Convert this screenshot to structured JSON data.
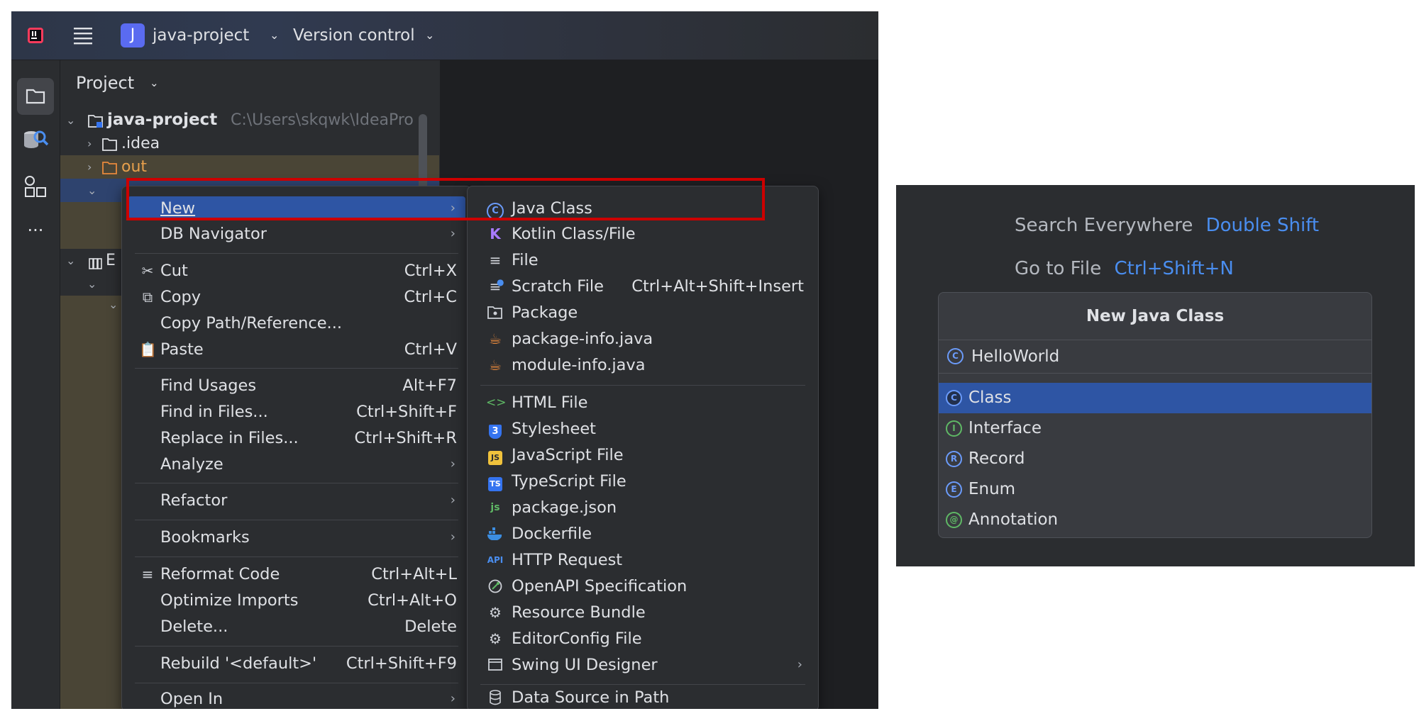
{
  "titlebar": {
    "project_badge": "J",
    "project_name": "java-project",
    "vcs_label": "Version control"
  },
  "sidebar": {
    "icons": [
      "folder-icon",
      "db-search-icon",
      "plugins-icon",
      "more-icon"
    ],
    "more_label": "···"
  },
  "project_panel": {
    "title": "Project",
    "rows": [
      {
        "name": "java-project",
        "path": "C:\\Users\\skqwk\\IdeaPro"
      },
      {
        "name": ".idea"
      },
      {
        "name": "out"
      }
    ],
    "partial_row_letter": "E"
  },
  "context_menu": {
    "items": [
      {
        "label": "New",
        "shortcut": "",
        "submenu": true
      },
      {
        "label": "DB Navigator",
        "shortcut": "",
        "submenu": true
      },
      {
        "label": "Cut",
        "shortcut": "Ctrl+X",
        "icon": "scissors-icon"
      },
      {
        "label": "Copy",
        "shortcut": "Ctrl+C",
        "icon": "copy-icon"
      },
      {
        "label": "Copy Path/Reference...",
        "shortcut": ""
      },
      {
        "label": "Paste",
        "shortcut": "Ctrl+V",
        "icon": "paste-icon"
      },
      {
        "label": "Find Usages",
        "shortcut": "Alt+F7"
      },
      {
        "label": "Find in Files...",
        "shortcut": "Ctrl+Shift+F"
      },
      {
        "label": "Replace in Files...",
        "shortcut": "Ctrl+Shift+R"
      },
      {
        "label": "Analyze",
        "shortcut": "",
        "submenu": true
      },
      {
        "label": "Refactor",
        "shortcut": "",
        "submenu": true
      },
      {
        "label": "Bookmarks",
        "shortcut": "",
        "submenu": true
      },
      {
        "label": "Reformat Code",
        "shortcut": "Ctrl+Alt+L",
        "icon": "reformat-icon"
      },
      {
        "label": "Optimize Imports",
        "shortcut": "Ctrl+Alt+O"
      },
      {
        "label": "Delete...",
        "shortcut": "Delete"
      },
      {
        "label": "Rebuild '<default>'",
        "shortcut": "Ctrl+Shift+F9"
      },
      {
        "label": "Open In",
        "shortcut": "",
        "submenu": true
      }
    ]
  },
  "new_submenu": {
    "items": [
      {
        "label": "Java Class",
        "icon": "java-class-icon"
      },
      {
        "label": "Kotlin Class/File",
        "icon": "kotlin-icon"
      },
      {
        "label": "File",
        "icon": "file-icon"
      },
      {
        "label": "Scratch File",
        "shortcut": "Ctrl+Alt+Shift+Insert",
        "icon": "scratch-file-icon"
      },
      {
        "label": "Package",
        "icon": "package-icon"
      },
      {
        "label": "package-info.java",
        "icon": "java-cup-icon"
      },
      {
        "label": "module-info.java",
        "icon": "java-cup-icon"
      },
      {
        "label": "HTML File",
        "icon": "html-icon"
      },
      {
        "label": "Stylesheet",
        "icon": "css-icon"
      },
      {
        "label": "JavaScript File",
        "icon": "javascript-icon"
      },
      {
        "label": "TypeScript File",
        "icon": "typescript-icon"
      },
      {
        "label": "package.json",
        "icon": "nodejs-icon"
      },
      {
        "label": "Dockerfile",
        "icon": "docker-icon"
      },
      {
        "label": "HTTP Request",
        "icon": "api-icon"
      },
      {
        "label": "OpenAPI Specification",
        "icon": "openapi-icon"
      },
      {
        "label": "Resource Bundle",
        "icon": "gear-icon"
      },
      {
        "label": "EditorConfig File",
        "icon": "gear-icon"
      },
      {
        "label": "Swing UI Designer",
        "icon": "window-icon",
        "submenu": true
      },
      {
        "label": "Data Source in Path",
        "icon": "database-icon"
      }
    ],
    "glyphs": {
      "java_class": "C",
      "kotlin": "K",
      "html": "<>",
      "css": "3",
      "javascript": "JS",
      "typescript": "TS",
      "nodejs": "js",
      "api": "API"
    }
  },
  "right_panel": {
    "search_label": "Search Everywhere",
    "search_key": "Double Shift",
    "goto_label": "Go to File",
    "goto_key": "Ctrl+Shift+N",
    "dialog": {
      "title": "New Java Class",
      "input_value": "HelloWorld",
      "options": [
        {
          "label": "Class",
          "letter": "C",
          "color": "#6b9bfa",
          "selected": true
        },
        {
          "label": "Interface",
          "letter": "I",
          "color": "#5fb865",
          "selected": false
        },
        {
          "label": "Record",
          "letter": "R",
          "color": "#6b9bfa",
          "selected": false
        },
        {
          "label": "Enum",
          "letter": "E",
          "color": "#6b9bfa",
          "selected": false
        },
        {
          "label": "Annotation",
          "letter": "@",
          "color": "#5fb865",
          "selected": false
        }
      ]
    }
  },
  "colors": {
    "selection": "#2e55a4",
    "highlight_box": "#cc0000",
    "shortcut_key": "#4a8ef0"
  }
}
